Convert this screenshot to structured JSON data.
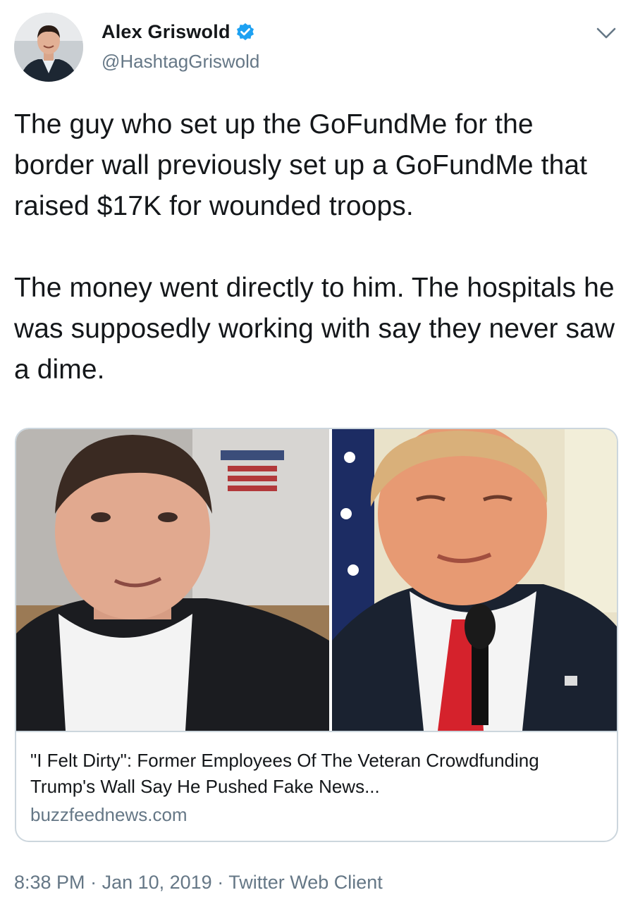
{
  "author": {
    "display_name": "Alex Griswold",
    "handle": "@HashtagGriswold",
    "verified": true,
    "avatar_icon": "profile-photo"
  },
  "tweet": {
    "text": "The guy who set up the GoFundMe for the border wall previously set up a GoFundMe that raised $17K for wounded troops.\n\nThe money went directly to him. The hospitals he was supposedly working with say they never saw a dime."
  },
  "card": {
    "title": "\"I Felt Dirty\": Former Employees Of The Veteran Crowdfunding Trump's Wall Say He Pushed Fake News...",
    "domain": "buzzfeednews.com",
    "image_left_icon": "man-photo",
    "image_right_icon": "trump-photo"
  },
  "meta": {
    "time": "8:38 PM",
    "separator": " · ",
    "date": "Jan 10, 2019",
    "client": "Twitter Web Client"
  },
  "colors": {
    "text": "#14171a",
    "secondary": "#657786",
    "verified_blue": "#1da1f2",
    "border": "#ccd6dd"
  }
}
